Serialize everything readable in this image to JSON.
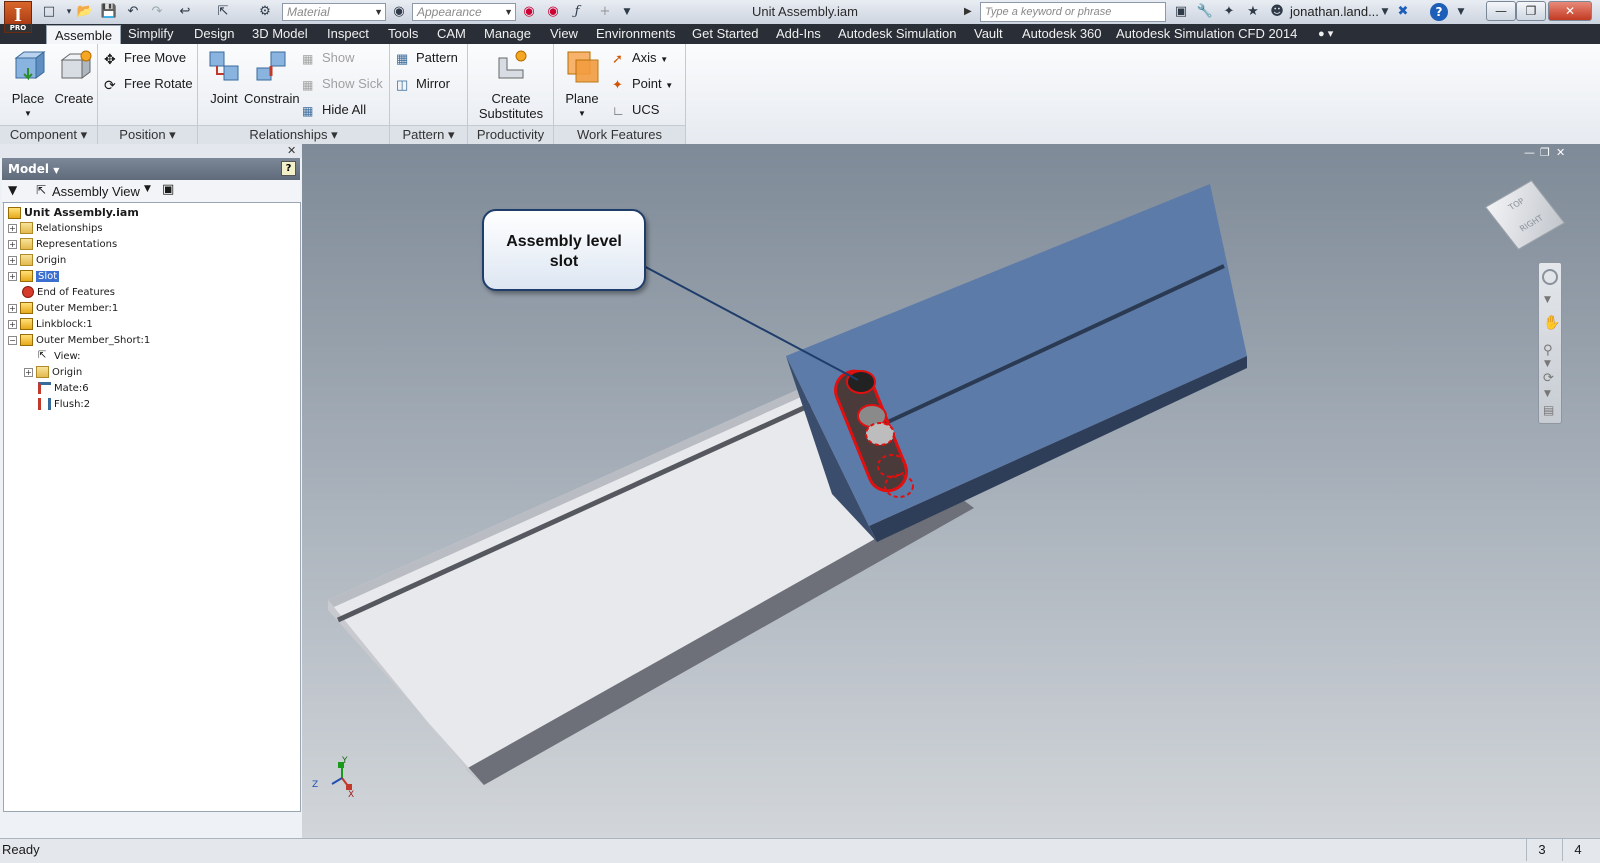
{
  "app": {
    "logo_letter": "I",
    "logo_sub": "PRO",
    "window_title": "Unit Assembly.iam",
    "material_placeholder": "Material",
    "appearance_placeholder": "Appearance",
    "search_placeholder": "Type a keyword or phrase",
    "user_name": "jonathan.land...",
    "accent_color": "#3a6fd0"
  },
  "tabs": [
    {
      "label": "Assemble",
      "active": true
    },
    {
      "label": "Simplify"
    },
    {
      "label": "Design"
    },
    {
      "label": "3D Model"
    },
    {
      "label": "Inspect"
    },
    {
      "label": "Tools"
    },
    {
      "label": "CAM"
    },
    {
      "label": "Manage"
    },
    {
      "label": "View"
    },
    {
      "label": "Environments"
    },
    {
      "label": "Get Started"
    },
    {
      "label": "Add-Ins"
    },
    {
      "label": "Autodesk Simulation"
    },
    {
      "label": "Vault"
    },
    {
      "label": "Autodesk 360"
    },
    {
      "label": "Autodesk Simulation CFD 2014"
    }
  ],
  "ribbon": {
    "component": {
      "title": "Component",
      "place": "Place",
      "create": "Create"
    },
    "position": {
      "title": "Position",
      "free_move": "Free Move",
      "free_rotate": "Free Rotate"
    },
    "relationships": {
      "title": "Relationships",
      "joint": "Joint",
      "constrain": "Constrain",
      "show": "Show",
      "show_sick": "Show Sick",
      "hide_all": "Hide All"
    },
    "pattern": {
      "title": "Pattern",
      "pattern": "Pattern",
      "mirror": "Mirror"
    },
    "productivity": {
      "title": "Productivity",
      "create_substitutes_1": "Create",
      "create_substitutes_2": "Substitutes"
    },
    "work_features": {
      "title": "Work Features",
      "plane": "Plane",
      "axis": "Axis",
      "point": "Point",
      "ucs": "UCS"
    }
  },
  "browser": {
    "header": "Model",
    "view_selector": "Assembly View",
    "tree": [
      {
        "label": "Unit Assembly.iam"
      },
      {
        "label": "Relationships"
      },
      {
        "label": "Representations"
      },
      {
        "label": "Origin"
      },
      {
        "label": "Slot"
      },
      {
        "label": "End of Features"
      },
      {
        "label": "Outer Member:1"
      },
      {
        "label": "Linkblock:1"
      },
      {
        "label": "Outer Member_Short:1"
      },
      {
        "label": "View:"
      },
      {
        "label": "Origin"
      },
      {
        "label": "Mate:6"
      },
      {
        "label": "Flush:2"
      }
    ]
  },
  "viewport": {
    "callout_line1": "Assembly level",
    "callout_line2": "slot",
    "viewcube_top": "TOP",
    "viewcube_right": "RIGHT",
    "axis_x": "X",
    "axis_y": "Y",
    "axis_z": "Z"
  },
  "status": {
    "text": "Ready",
    "count_a": "3",
    "count_b": "4"
  }
}
